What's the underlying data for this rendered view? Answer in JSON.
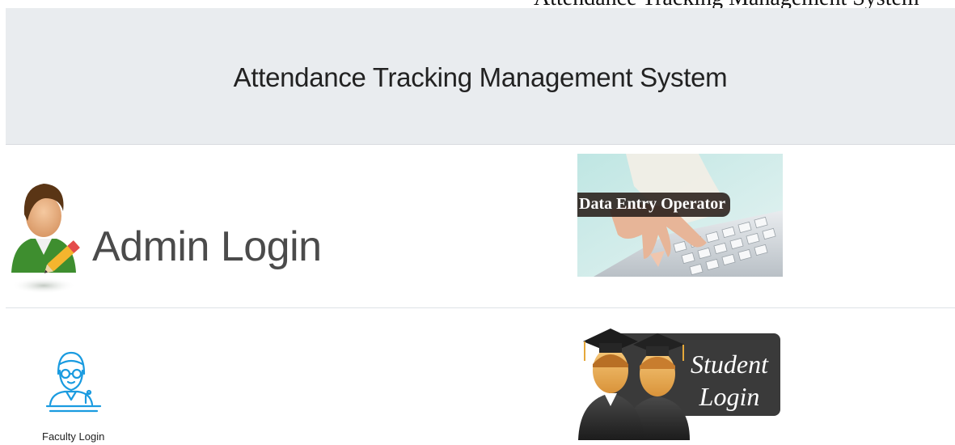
{
  "page": {
    "title": "Attendance Tracking Management System"
  },
  "tiles": {
    "admin": {
      "label": "Admin Login",
      "icon": "admin-user-pencil-icon"
    },
    "data_entry": {
      "label": "Data Entry Operator",
      "icon": "keyboard-hand-photo"
    },
    "faculty": {
      "label": "Faculty Login",
      "icon": "teacher-podium-icon"
    },
    "student": {
      "label_line1": "Student",
      "label_line2": "Login",
      "icon": "graduates-icon"
    }
  },
  "colors": {
    "header_bg": "#e9ecef",
    "admin_text": "#4b4b4b",
    "faculty_icon": "#1a9be0",
    "student_bg": "#3a3a3a",
    "admin_shirt": "#3e8e2f"
  }
}
